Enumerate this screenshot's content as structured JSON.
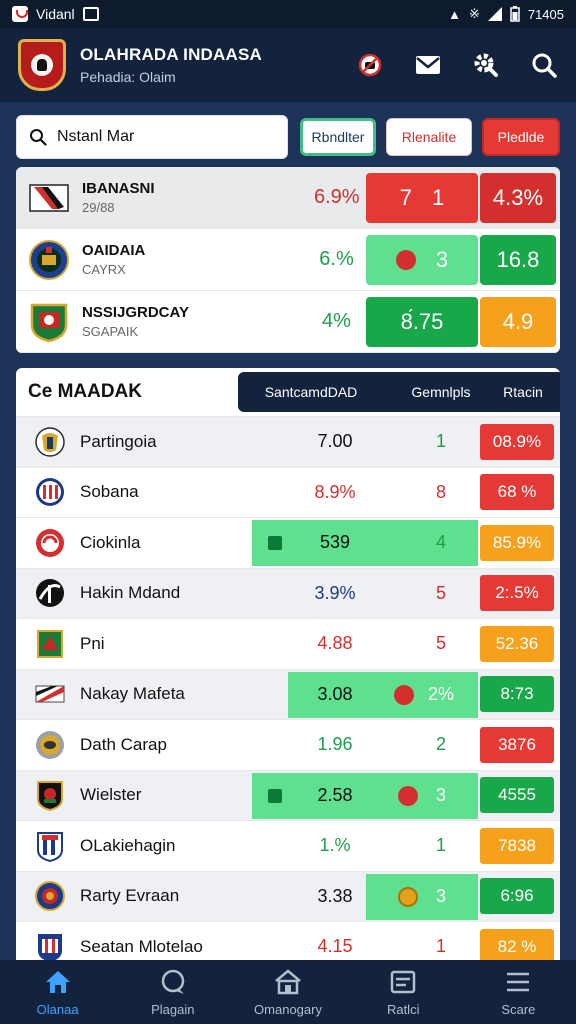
{
  "status_bar": {
    "app_label": "Vidanl",
    "time": "71405",
    "icons": [
      "app-icon",
      "mail-icon",
      "notification-icon",
      "bluetooth-icon",
      "signal-icon",
      "battery-icon"
    ]
  },
  "header": {
    "title": "OLAHRADA INDAASA",
    "subtitle": "Pehadia: Olaim",
    "icons": [
      "no-notifications-icon",
      "mail-icon",
      "settings-icon",
      "search-icon"
    ]
  },
  "search": {
    "value": "Nstanl Mar",
    "placeholder": "Search"
  },
  "filters": [
    {
      "label": "Rbndlter"
    },
    {
      "label": "Rlenalite"
    },
    {
      "label": "Pledlde"
    }
  ],
  "top_teams": [
    {
      "name": "IBANASNI",
      "sub": "29/88",
      "pct": "6.9%",
      "pct_color": "#d32f2f",
      "mid_a": "7",
      "mid_b": "1",
      "mid_bg": "#e53935",
      "mid_color": "#ffffff",
      "end": "4.3%",
      "end_bg": "#d32f2f"
    },
    {
      "name": "OAIDAIA",
      "sub": "CAYRX",
      "pct": "6.%",
      "pct_color": "#1e9e4a",
      "mid_a": "",
      "mid_b": "3",
      "mid_bg": "#5ee08f",
      "mid_color": "#ffffff",
      "end": "16.8",
      "end_bg": "#18a84a"
    },
    {
      "name": "NSSIJGRDCAY",
      "sub": "SGAPAIK",
      "pct": "4%",
      "pct_color": "#1e9e4a",
      "mid_a": "8́.75",
      "mid_b": "",
      "mid_bg": "#18a84a",
      "mid_color": "#ffffff",
      "end": "4.9",
      "end_bg": "#f5a11b"
    }
  ],
  "league": {
    "title": "Ce MAADAK",
    "columns": [
      "SantcamdDAD",
      "Gemnlpls",
      "Rtacin"
    ],
    "rows": [
      {
        "name": "Partingoia",
        "v1": "7.00",
        "v1_color": "#111111",
        "v2": "1",
        "v2_color": "#1e9e4a",
        "badge": "08.9%",
        "badge_bg": "#e53935"
      },
      {
        "name": "Sobana",
        "v1": "8.9%",
        "v1_color": "#d32f2f",
        "v2": "8",
        "v2_color": "#d32f2f",
        "badge": "68 %",
        "badge_bg": "#e53935"
      },
      {
        "name": "Ciokinla",
        "v1": "539",
        "v1_color": "#111111",
        "v2": "4",
        "v2_color": "#1e9e4a",
        "badge": "85.9%",
        "badge_bg": "#f5a11b"
      },
      {
        "name": "Hakin Mdand",
        "v1": "3.9%",
        "v1_color": "#1b3a8a",
        "v2": "5",
        "v2_color": "#d32f2f",
        "badge": "2:.5%",
        "badge_bg": "#e53935"
      },
      {
        "name": "Pni",
        "v1": "4.88",
        "v1_color": "#d32f2f",
        "v2": "5",
        "v2_color": "#d32f2f",
        "badge": "52.36",
        "badge_bg": "#f5a11b"
      },
      {
        "name": "Nakay Mafeta",
        "v1": "3.08",
        "v1_color": "#111111",
        "v2": "2%",
        "v2_color": "#ffffff",
        "badge": "8:73",
        "badge_bg": "#18a84a"
      },
      {
        "name": "Dath Carap",
        "v1": "1.96",
        "v1_color": "#1e9e4a",
        "v2": "2",
        "v2_color": "#1e9e4a",
        "badge": "3876",
        "badge_bg": "#e53935"
      },
      {
        "name": "Wielster",
        "v1": "2.58",
        "v1_color": "#111111",
        "v2": "3",
        "v2_color": "#ffffff",
        "badge": "4555",
        "badge_bg": "#18a84a"
      },
      {
        "name": "OLakiehagin",
        "v1": "1.%",
        "v1_color": "#1e9e4a",
        "v2": "1",
        "v2_color": "#1e9e4a",
        "badge": "7838",
        "badge_bg": "#f5a11b"
      },
      {
        "name": "Rarty Evraan",
        "v1": "3.38",
        "v1_color": "#111111",
        "v2": "3",
        "v2_color": "#ffffff",
        "badge": "6:96",
        "badge_bg": "#18a84a"
      },
      {
        "name": "Seatan Mlotelao",
        "v1": "4.15",
        "v1_color": "#d32f2f",
        "v2": "1",
        "v2_color": "#d32f2f",
        "badge": "82 %",
        "badge_bg": "#f5a11b"
      }
    ]
  },
  "nav": [
    {
      "label": "Olanaa",
      "icon": "home-icon",
      "active": true
    },
    {
      "label": "Plagain",
      "icon": "chat-icon",
      "active": false
    },
    {
      "label": "Omanogary",
      "icon": "store-icon",
      "active": false
    },
    {
      "label": "Ratlci",
      "icon": "stats-icon",
      "active": false
    },
    {
      "label": "Scare",
      "icon": "menu-icon",
      "active": false
    }
  ]
}
